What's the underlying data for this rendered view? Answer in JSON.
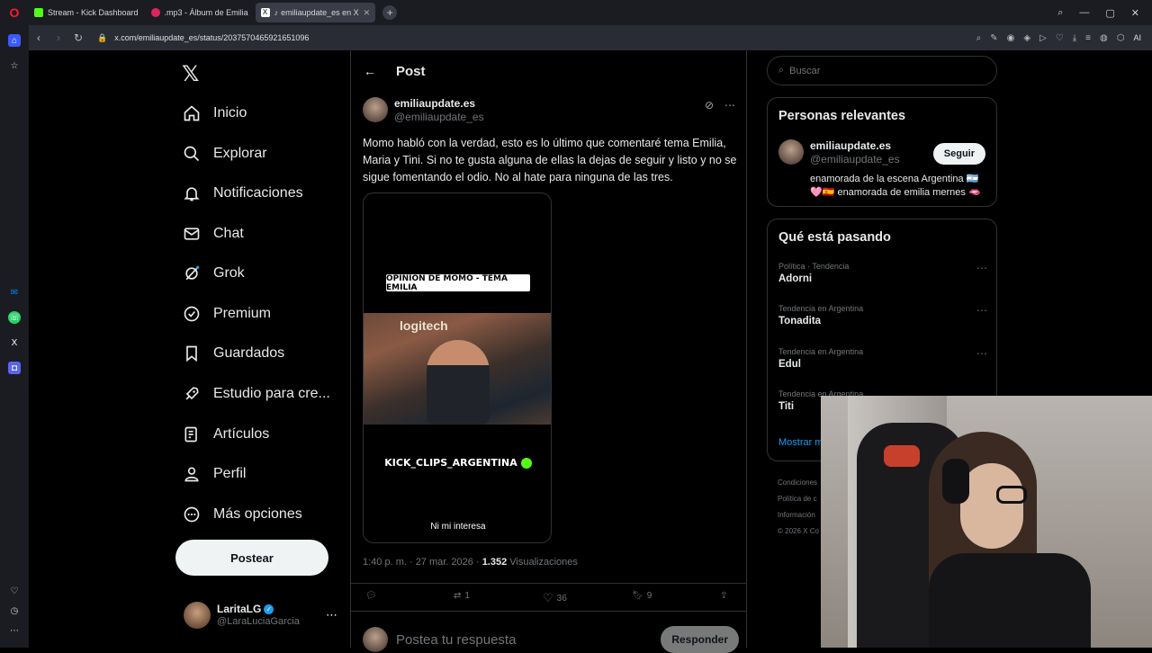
{
  "browser": {
    "tabs": [
      {
        "label": "Stream - Kick Dashboard",
        "color": "#53fc18"
      },
      {
        "label": ".mp3 - Álbum de Emilia",
        "color": "#e0245e"
      },
      {
        "label": "emiliaupdate_es en X",
        "color": "#ffffff"
      }
    ],
    "url": "x.com/emiliaupdate_es/status/2037570465921651096",
    "ai_label": "AI"
  },
  "nav": {
    "items": [
      {
        "label": "Inicio",
        "icon": "home-icon"
      },
      {
        "label": "Explorar",
        "icon": "search-icon"
      },
      {
        "label": "Notificaciones",
        "icon": "bell-icon"
      },
      {
        "label": "Chat",
        "icon": "mail-icon"
      },
      {
        "label": "Grok",
        "icon": "grok-icon"
      },
      {
        "label": "Premium",
        "icon": "verified-icon"
      },
      {
        "label": "Guardados",
        "icon": "bookmark-icon"
      },
      {
        "label": "Estudio para cre...",
        "icon": "rocket-icon"
      },
      {
        "label": "Artículos",
        "icon": "article-icon"
      },
      {
        "label": "Perfil",
        "icon": "person-icon"
      },
      {
        "label": "Más opciones",
        "icon": "more-circle-icon"
      }
    ],
    "post_button": "Postear",
    "account": {
      "name": "LaritaLG",
      "handle": "@LaraLuciaGarcia"
    }
  },
  "post": {
    "header_title": "Post",
    "author_name": "emiliaupdate.es",
    "author_handle": "@emiliaupdate_es",
    "text": "Momo habló con la verdad, esto es lo último que comentaré tema Emilia, Maria y Tini. Si no te gusta alguna de ellas la dejas de seguir y listo y no se sigue fomentando el odio. No al hate para ninguna de las tres.",
    "media": {
      "banner": "OPINIÓN DE MOMO - TEMA EMILIA",
      "brand": "logitech",
      "channel": "KICK_CLIPS_ARGENTINA",
      "caption": "Ni mi interesa"
    },
    "meta_time": "1:40 p. m. · 27 mar. 2026 · ",
    "views_count": "1.352",
    "views_label": " Visualizaciones",
    "reposts": "1",
    "likes": "36",
    "bookmarks": "9",
    "reply_placeholder": "Postea tu respuesta",
    "reply_button": "Responder"
  },
  "sidebar": {
    "search_placeholder": "Buscar",
    "relevant_title": "Personas relevantes",
    "relevant_user": {
      "name": "emiliaupdate.es",
      "handle": "@emiliaupdate_es",
      "follow": "Seguir",
      "bio": "enamorada de la escena Argentina 🇦🇷 🩷🇪🇸 enamorada de emilia mernes 🫦"
    },
    "trending_title": "Qué está pasando",
    "trends": [
      {
        "context": "Política · Tendencia",
        "name": "Adorni"
      },
      {
        "context": "Tendencia en Argentina",
        "name": "Tonadita"
      },
      {
        "context": "Tendencia en Argentina",
        "name": "Edul"
      },
      {
        "context": "Tendencia en Argentina",
        "name": "Titi"
      }
    ],
    "show_more": "Mostrar m",
    "footer": [
      "Condiciones",
      "Política de c",
      "Información",
      "© 2026 X Co"
    ]
  }
}
